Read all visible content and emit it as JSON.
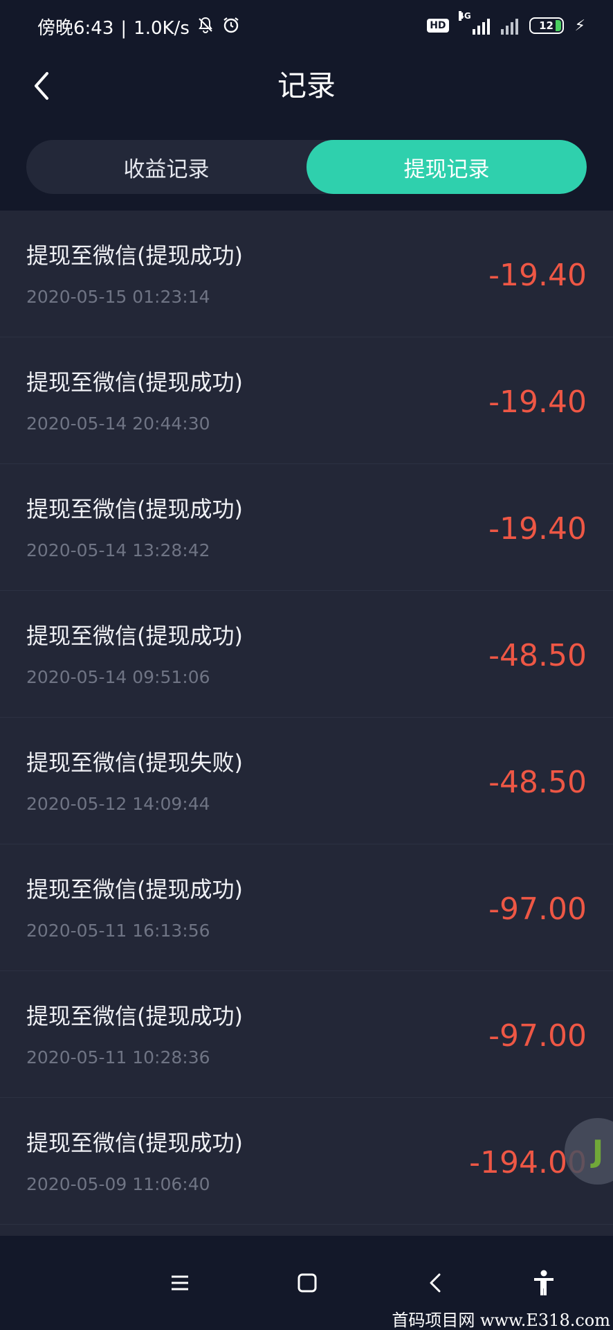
{
  "status_bar": {
    "time": "傍晚6:43",
    "speed": "1.0K/s",
    "hd": "HD",
    "network": "4G",
    "battery": "12"
  },
  "header": {
    "title": "记录"
  },
  "tabs": [
    {
      "label": "收益记录",
      "active": false
    },
    {
      "label": "提现记录",
      "active": true
    }
  ],
  "records": [
    {
      "title": "提现至微信(提现成功)",
      "time": "2020-05-15 01:23:14",
      "amount": "-19.40"
    },
    {
      "title": "提现至微信(提现成功)",
      "time": "2020-05-14 20:44:30",
      "amount": "-19.40"
    },
    {
      "title": "提现至微信(提现成功)",
      "time": "2020-05-14 13:28:42",
      "amount": "-19.40"
    },
    {
      "title": "提现至微信(提现成功)",
      "time": "2020-05-14 09:51:06",
      "amount": "-48.50"
    },
    {
      "title": "提现至微信(提现失败)",
      "time": "2020-05-12 14:09:44",
      "amount": "-48.50"
    },
    {
      "title": "提现至微信(提现成功)",
      "time": "2020-05-11 16:13:56",
      "amount": "-97.00"
    },
    {
      "title": "提现至微信(提现成功)",
      "time": "2020-05-11 10:28:36",
      "amount": "-97.00"
    },
    {
      "title": "提现至微信(提现成功)",
      "time": "2020-05-09 11:06:40",
      "amount": "-194.00"
    }
  ],
  "float_badge": {
    "label": "J"
  },
  "watermark": "首码项目网 www.E318.com",
  "colors": {
    "background": "#131829",
    "list_bg": "#232737",
    "accent": "#2fd0ad",
    "amount": "#ee5745"
  }
}
